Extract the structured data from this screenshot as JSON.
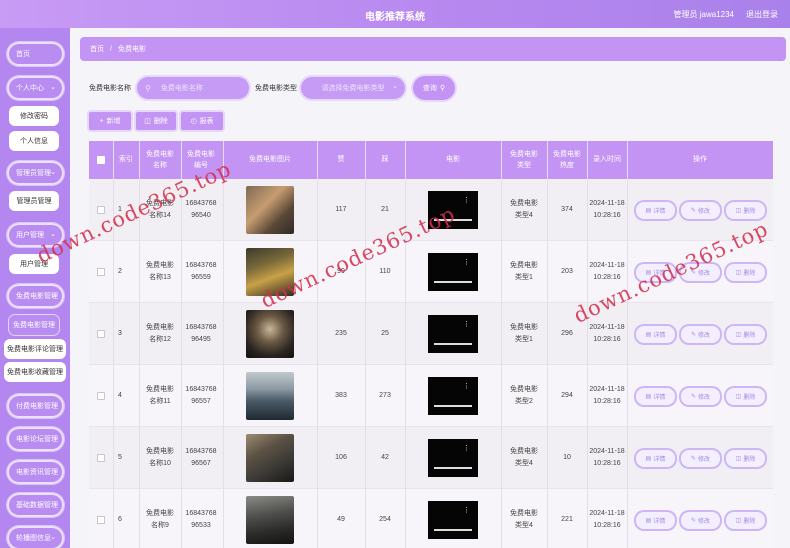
{
  "header": {
    "title": "电影推荐系统",
    "user": "管理员 jawa1234",
    "logout": "退出登录"
  },
  "sidebar": {
    "home": "首页",
    "personal_center": "个人中心",
    "change_password": "修改密码",
    "personal_info": "个人信息",
    "admin_mgmt": "管理员管理",
    "admin_mgmt_sub": "管理员管理",
    "user_mgmt": "用户管理",
    "user_mgmt_sub": "用户管理",
    "movie_mgmt": "免费电影管理",
    "movie_mgmt_sub": "免费电影管理",
    "movie_comment_mgmt": "免费电影评论管理",
    "movie_fav_mgmt": "免费电影收藏管理",
    "paid_movie_mgmt": "付费电影管理",
    "forum_mgmt": "电影论坛管理",
    "news_mgmt": "电影资讯管理",
    "basic_data_mgmt": "基础数据管理",
    "carousel_mgmt": "轮播图信息"
  },
  "breadcrumb": {
    "home": "首页",
    "sep": "/",
    "current": "免费电影"
  },
  "search": {
    "name_label": "免费电影名称",
    "name_placeholder": "免费电影名称",
    "type_label": "免费电影类型",
    "type_placeholder": "请选择免费电影类型",
    "button": "查询"
  },
  "actions": {
    "add": "新增",
    "delete": "删除",
    "report": "报表"
  },
  "table": {
    "headers": [
      "索引",
      "免费电影名称",
      "免费电影编号",
      "免费电影图片",
      "赞",
      "踩",
      "电影",
      "免费电影类型",
      "免费电影热度",
      "录入时间",
      "操作"
    ],
    "row_buttons": {
      "detail": "详情",
      "edit": "修改",
      "delete": "删除"
    },
    "rows": [
      {
        "index": "1",
        "name": "免费电影名称14",
        "code": "1684376896540",
        "likes": "117",
        "dislikes": "21",
        "type": "免费电影类型4",
        "heat": "374",
        "time": "2024-11-18 10:28:16"
      },
      {
        "index": "2",
        "name": "免费电影名称13",
        "code": "1684376896559",
        "likes": "99",
        "dislikes": "110",
        "type": "免费电影类型1",
        "heat": "203",
        "time": "2024-11-18 10:28:16"
      },
      {
        "index": "3",
        "name": "免费电影名称12",
        "code": "1684376896495",
        "likes": "235",
        "dislikes": "25",
        "type": "免费电影类型1",
        "heat": "296",
        "time": "2024-11-18 10:28:16"
      },
      {
        "index": "4",
        "name": "免费电影名称11",
        "code": "1684376896557",
        "likes": "383",
        "dislikes": "273",
        "type": "免费电影类型2",
        "heat": "294",
        "time": "2024-11-18 10:28:16"
      },
      {
        "index": "5",
        "name": "免费电影名称10",
        "code": "1684376896567",
        "likes": "106",
        "dislikes": "42",
        "type": "免费电影类型4",
        "heat": "10",
        "time": "2024-11-18 10:28:16"
      },
      {
        "index": "6",
        "name": "免费电影名称9",
        "code": "1684376896533",
        "likes": "49",
        "dislikes": "254",
        "type": "免费电影类型4",
        "heat": "221",
        "time": "2024-11-18 10:28:16"
      }
    ]
  },
  "watermark": "down.code365.top",
  "colors": {
    "accent": "#c394f4",
    "sidebar": "#b386f0",
    "watermark": "#d3314f"
  },
  "icons": {
    "search": "search-icon",
    "add": "plus-icon",
    "delete": "trash-icon",
    "report": "chart-icon",
    "select": "chevron-down-icon"
  }
}
